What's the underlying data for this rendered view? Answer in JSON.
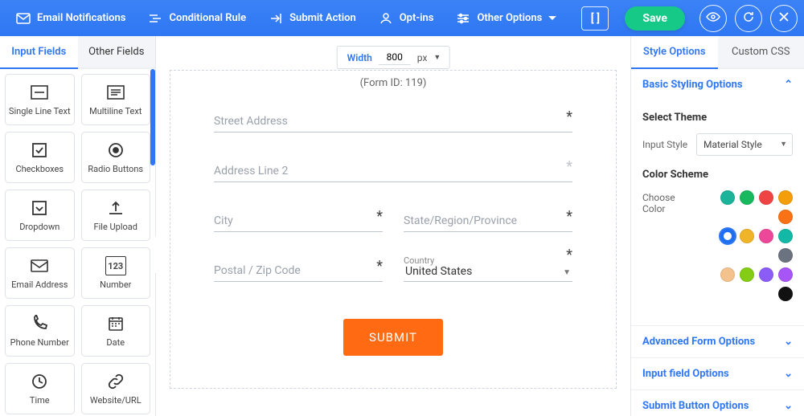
{
  "toolbar": {
    "email": "Email Notifications",
    "conditional": "Conditional Rule",
    "submit_action": "Submit Action",
    "optins": "Opt-ins",
    "other": "Other Options",
    "save": "Save"
  },
  "left": {
    "tab_input": "Input Fields",
    "tab_other": "Other Fields",
    "tiles": {
      "single_line": "Single Line Text",
      "multiline": "Multiline Text",
      "checkboxes": "Checkboxes",
      "radio": "Radio Buttons",
      "dropdown": "Dropdown",
      "file_upload": "File Upload",
      "email": "Email Address",
      "number": "Number",
      "phone": "Phone Number",
      "date": "Date",
      "time": "Time",
      "url": "Website/URL"
    }
  },
  "center": {
    "width_label": "Width",
    "width_value": "800",
    "width_unit": "px",
    "form_id": "(Form ID: 119)",
    "fields": {
      "street": "Street Address",
      "line2": "Address Line 2",
      "city": "City",
      "state": "State/Region/Province",
      "postal": "Postal / Zip Code",
      "country_label": "Country",
      "country_value": "United States"
    },
    "submit": "SUBMIT"
  },
  "right": {
    "tab_style": "Style Options",
    "tab_css": "Custom CSS",
    "basic": "Basic Styling Options",
    "select_theme": "Select Theme",
    "input_style_label": "Input Style",
    "input_style_value": "Material Style",
    "color_scheme": "Color Scheme",
    "choose_color": "Choose Color",
    "advanced": "Advanced Form Options",
    "input_field": "Input field Options",
    "submit_btn": "Submit Button Options",
    "colors_row1": [
      "#1cb39b",
      "#18b85e",
      "#ef4444",
      "#f59e0b",
      "#f97316"
    ],
    "colors_row2": [
      "#1e6ff0",
      "#f0b429",
      "#ec4899",
      "#14b8a6",
      "#6b7280"
    ],
    "colors_row3": [
      "#f4c28c",
      "#84cc16",
      "#8b5cf6",
      "#a855f7",
      "#111111"
    ],
    "selected_color_index": 0
  }
}
